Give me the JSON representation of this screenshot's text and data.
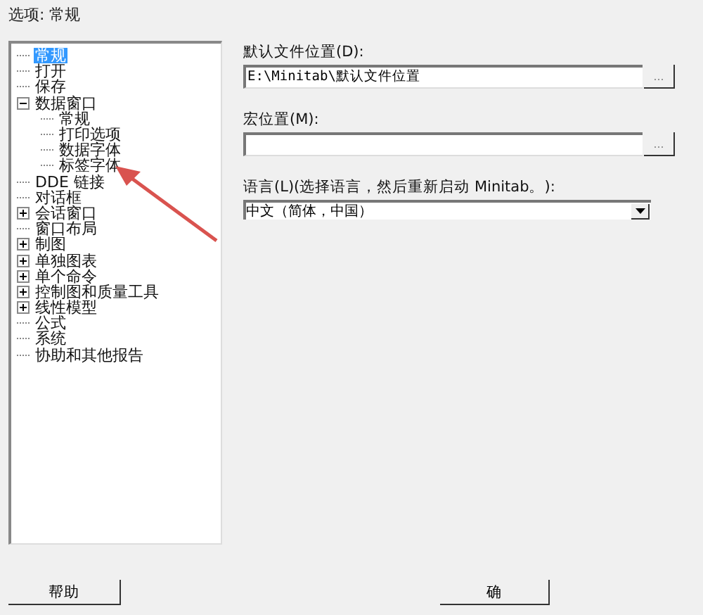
{
  "window": {
    "title": "选项: 常规"
  },
  "tree": {
    "items": [
      {
        "label": "常规",
        "selected": true
      },
      {
        "label": "打开",
        "selected": false
      },
      {
        "label": "保存",
        "selected": false
      },
      {
        "label": "数据窗口",
        "selected": false,
        "expanded": true,
        "children": [
          {
            "label": "常规",
            "selected": false
          },
          {
            "label": "打印选项",
            "selected": false
          },
          {
            "label": "数据字体",
            "selected": false
          },
          {
            "label": "标签字体",
            "selected": false
          }
        ]
      },
      {
        "label": "DDE 链接",
        "selected": false
      },
      {
        "label": "对话框",
        "selected": false
      },
      {
        "label": "会话窗口",
        "selected": false,
        "expanded": false
      },
      {
        "label": "窗口布局",
        "selected": false
      },
      {
        "label": "制图",
        "selected": false,
        "expanded": false
      },
      {
        "label": "单独图表",
        "selected": false,
        "expanded": false
      },
      {
        "label": "单个命令",
        "selected": false,
        "expanded": false
      },
      {
        "label": "控制图和质量工具",
        "selected": false,
        "expanded": false
      },
      {
        "label": "线性模型",
        "selected": false,
        "expanded": false
      },
      {
        "label": "公式",
        "selected": false
      },
      {
        "label": "系统",
        "selected": false
      },
      {
        "label": "协助和其他报告",
        "selected": false
      }
    ]
  },
  "fields": [
    {
      "kind": "path",
      "label": "默认文件位置(D):",
      "value": "E:\\Minitab\\默认文件位置",
      "browse": "..."
    },
    {
      "kind": "path",
      "label": "宏位置(M):",
      "browse": "..."
    },
    {
      "kind": "combo",
      "label": "语言(L)(选择语言，然后重新启动 Minitab。):",
      "value": "中文（简体，中国）"
    }
  ],
  "buttons": [
    {
      "label": "帮助"
    },
    {
      "label": "确"
    }
  ]
}
